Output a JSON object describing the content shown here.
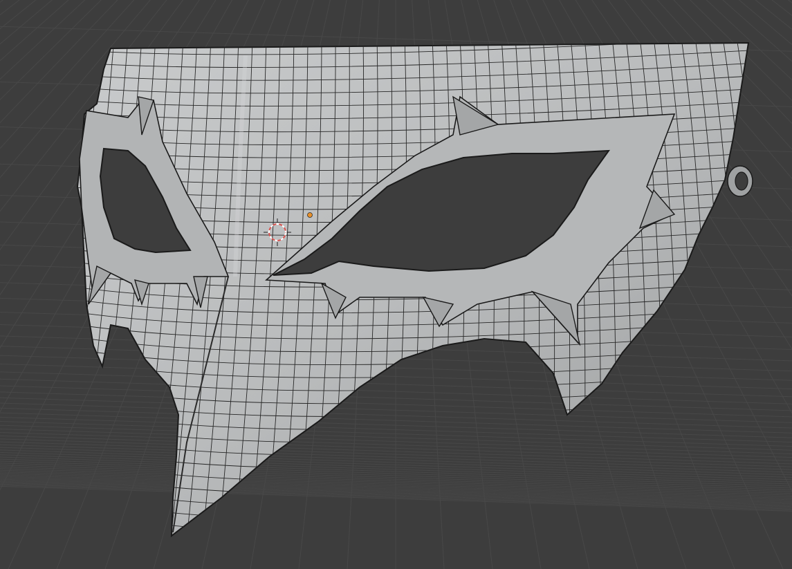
{
  "viewport": {
    "mode": "3D Viewport",
    "shading": "solid",
    "overlay": "wireframe",
    "object": "mask-mesh"
  },
  "colors": {
    "background": "#3d3d3d",
    "grid_line": "#4a4a4a",
    "mesh_surface": "#b8babb",
    "mesh_surface_light": "#c9cbcc",
    "mesh_surface_dark": "#8f9192",
    "wire": "#1e1e1e",
    "cursor_red": "#d9534f",
    "cursor_white": "#ffffff",
    "origin": "#e8902a"
  }
}
